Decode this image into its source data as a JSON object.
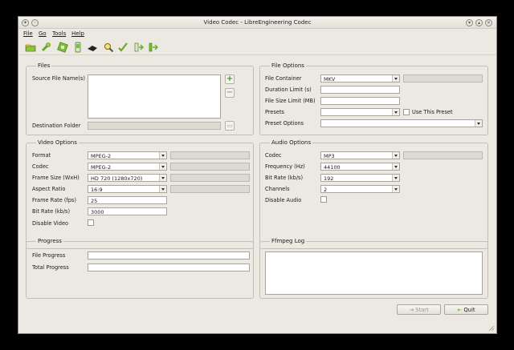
{
  "window": {
    "title": "Video Codec - LibreEngineering Codec"
  },
  "menu": {
    "file": "File",
    "go": "Go",
    "tools": "Tools",
    "help": "Help"
  },
  "toolbar": {
    "icons": [
      "folder-open-icon",
      "tool-icon",
      "film-icon",
      "phone-icon",
      "mouse-icon",
      "magnifier-icon",
      "checkmark-icon",
      "import-icon",
      "export-icon"
    ]
  },
  "files": {
    "title": "Files",
    "source_label": "Source File Name(s)",
    "add_symbol": "+",
    "remove_symbol": "−",
    "destination_label": "Destination Folder",
    "destination_value": ""
  },
  "file_options": {
    "title": "File Options",
    "container_label": "File Container",
    "container_value": "MKV",
    "duration_label": "Duration Limit (s)",
    "duration_value": "",
    "size_label": "File Size Limit (MB)",
    "size_value": "",
    "presets_label": "Presets",
    "presets_value": "",
    "use_preset_label": "Use This Preset",
    "preset_options_label": "Preset Options",
    "preset_options_value": ""
  },
  "video_options": {
    "title": "Video Options",
    "format_label": "Format",
    "format_value": "MPEG-2",
    "codec_label": "Codec",
    "codec_value": "MPEG-2",
    "frame_size_label": "Frame Size (WxH)",
    "frame_size_value": "HD 720 (1280x720)",
    "aspect_label": "Aspect Ratio",
    "aspect_value": "16:9",
    "frame_rate_label": "Frame Rate (fps)",
    "frame_rate_value": "25",
    "bit_rate_label": "Bit Rate (kb/s)",
    "bit_rate_value": "3000",
    "disable_label": "Disable Video"
  },
  "audio_options": {
    "title": "Audio Options",
    "codec_label": "Codec",
    "codec_value": "MP3",
    "frequency_label": "Frequency (Hz)",
    "frequency_value": "44100",
    "bit_rate_label": "Bit Rate (kb/s)",
    "bit_rate_value": "192",
    "channels_label": "Channels",
    "channels_value": "2",
    "disable_label": "Disable Audio"
  },
  "progress": {
    "title": "Progress",
    "file_label": "File Progress",
    "total_label": "Total Progress"
  },
  "log": {
    "title": "Ffmpeg Log"
  },
  "buttons": {
    "start": "Start",
    "quit": "Quit"
  }
}
